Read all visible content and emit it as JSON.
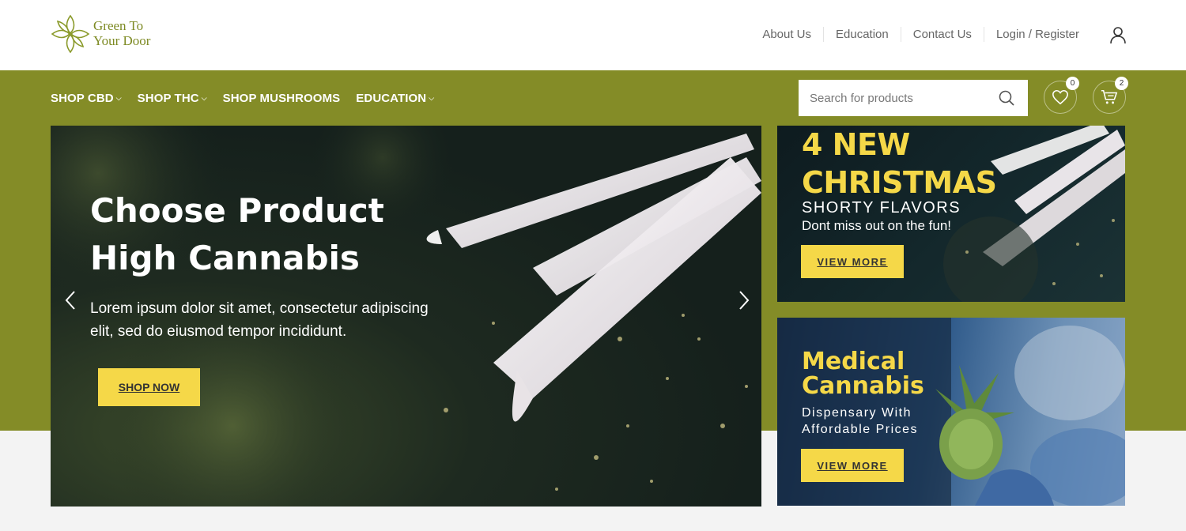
{
  "brand": {
    "line1": "Green To",
    "line2": "Your Door",
    "color": "#7d8a23"
  },
  "top_links": [
    "About Us",
    "Education",
    "Contact Us",
    "Login / Register"
  ],
  "nav": {
    "items": [
      {
        "label": "SHOP CBD",
        "has_dropdown": true
      },
      {
        "label": "SHOP THC",
        "has_dropdown": true
      },
      {
        "label": "SHOP MUSHROOMS",
        "has_dropdown": false
      },
      {
        "label": "EDUCATION",
        "has_dropdown": true
      }
    ],
    "search_placeholder": "Search for products",
    "wishlist_count": "0",
    "cart_count": "2",
    "bar_color": "#848c27"
  },
  "hero": {
    "title_line1": "Choose Product",
    "title_line2": "High Cannabis",
    "text_line1": "Lorem ipsum dolor sit amet, consectetur adipiscing",
    "text_line2": "elit, sed do eiusmod tempor incididunt.",
    "button": "SHOP NOW"
  },
  "banner1": {
    "title_line1": "4 NEW",
    "title_line2": "CHRISTMAS",
    "subtitle": "SHORTY FLAVORS",
    "tagline": "Dont miss out on the fun!",
    "button": "VIEW MORE"
  },
  "banner2": {
    "title_line1": "Medical",
    "title_line2": "Cannabis",
    "subtitle_line1": "Dispensary With",
    "subtitle_line2": "Affordable Prices",
    "button": "VIEW MORE"
  },
  "accent_color": "#f5d848"
}
